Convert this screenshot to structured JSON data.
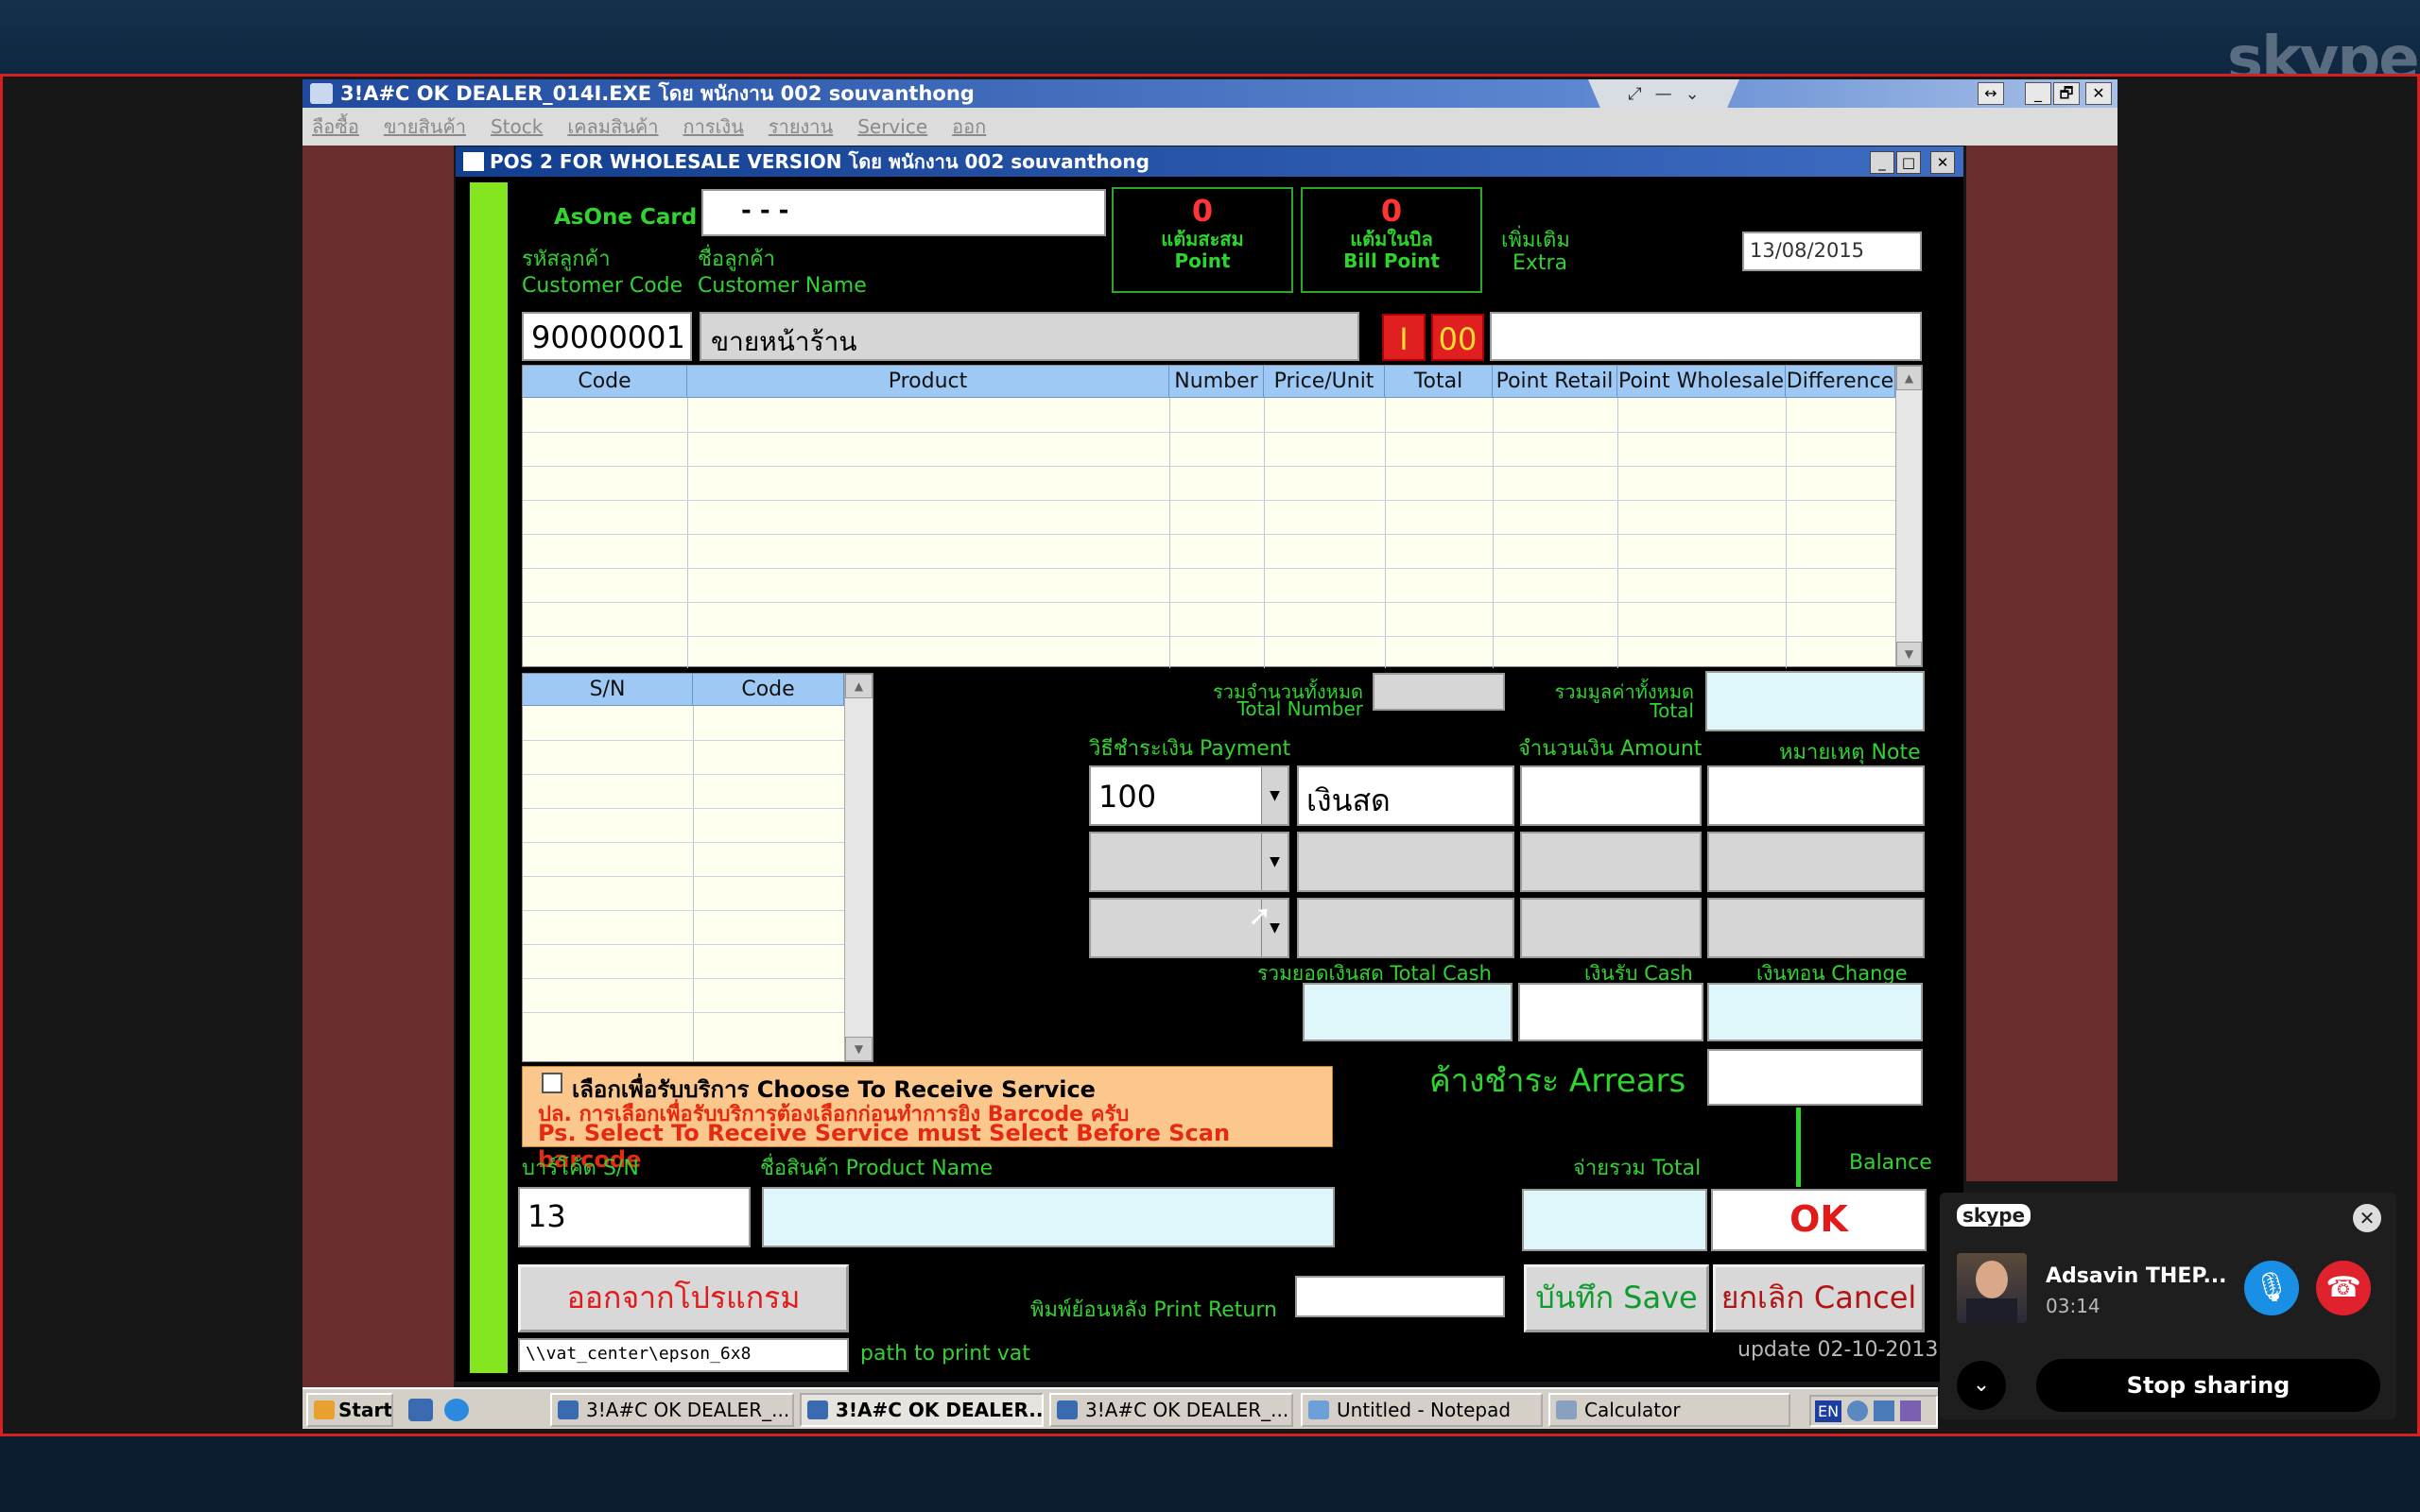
{
  "skype": {
    "brand": "skype",
    "caller_name": "Adsavin THEP...",
    "call_time": "03:14",
    "stop_sharing": "Stop sharing"
  },
  "outer_window": {
    "title": "3!A#C OK DEALER_014I.EXE โดย พนักงาน 002 souvanthong",
    "buttons": [
      "↔",
      "_",
      "🗗",
      "✕"
    ]
  },
  "menu": [
    "ลือซื้อ",
    "ขายสินค้า",
    "Stock",
    "เคลมสินค้า",
    "การเงิน",
    "รายงาน",
    "Service",
    "ออก"
  ],
  "inner_window": {
    "title": "POS 2 FOR WHOLESALE VERSION โดย พนักงาน 002 souvanthong",
    "buttons": [
      "_",
      "□",
      "✕"
    ]
  },
  "header": {
    "asone_label": "AsOne Card",
    "asone_value": "-   -   -",
    "cust_code_th": "รหัสลูกค้า",
    "cust_code_en": "Customer Code",
    "cust_name_th": "ชื่อลูกค้า",
    "cust_name_en": "Customer Name",
    "point_value": "0",
    "point_th": "แต้มสะสม",
    "point_en": "Point",
    "bill_point_value": "0",
    "bill_point_th": "แต้มในบิล",
    "bill_point_en": "Bill Point",
    "extra_th": "เพิ่มเติม",
    "extra_en": "Extra",
    "date": "13/08/2015",
    "customer_code": "90000001",
    "customer_name": "ขายหน้าร้าน",
    "flag_i": "I",
    "flag_00": "00",
    "extra_value": ""
  },
  "product_table": {
    "columns": [
      "Code",
      "Product",
      "Number",
      "Price/Unit",
      "Total",
      "Point Retail",
      "Point Wholesale",
      "Difference"
    ],
    "rows": []
  },
  "sn_table": {
    "columns": [
      "S/N",
      "Code"
    ],
    "rows": []
  },
  "totals": {
    "total_number_th": "รวมจำนวนทั้งหมด",
    "total_number_en": "Total Number",
    "total_number": "",
    "total_value_th": "รวมมูลค่าทั้งหมด",
    "total_value_en": "Total",
    "total_value": ""
  },
  "payment": {
    "method_label": "วิธีชำระเงิน Payment",
    "amount_label": "จำนวนเงิน Amount",
    "note_label": "หมายเหตุ Note",
    "row1_code": "100",
    "row1_name": "เงินสด",
    "row1_amount": "",
    "row1_note": "",
    "total_cash_label": "รวมยอดเงินสด Total Cash",
    "cash_label": "เงินรับ Cash",
    "change_label": "เงินทอน Change",
    "total_cash": "",
    "cash": "",
    "change": ""
  },
  "service": {
    "checkbox_label": "เลือกเพื่อรับบริการ Choose To Receive Service",
    "note_th": "ปล. การเลือกเพื่อรับบริการต้องเลือกก่อนทำการยิง Barcode ครับ",
    "note_en": "Ps. Select To Receive Service must Select Before Scan barcode",
    "checked": false
  },
  "arrears": {
    "label": "ค้างชำระ Arrears",
    "value": ""
  },
  "barcode": {
    "sn_label": "บาร์โค้ด S/N",
    "product_label": "ชื่อสินค้า Product Name",
    "sn_value": "13",
    "product_value": ""
  },
  "bottom": {
    "total_label": "จ่ายรวม Total",
    "balance_label": "Balance",
    "total_value": "",
    "ok": "OK",
    "close": "ออกจากโปรแกรม Close",
    "print_return_label": "พิมพ์ย้อนหลัง Print Return",
    "print_return_value": "",
    "save": "บันทึก Save",
    "cancel": "ยกเลิก Cancel",
    "path_value": "\\\\vat_center\\epson_6x8",
    "path_label": "path to print vat",
    "update": "update 02-10-2013"
  },
  "taskbar": {
    "start": "Start",
    "tasks": [
      "3!A#C OK DEALER_...",
      "3!A#C OK DEALER...",
      "3!A#C OK DEALER_...",
      "Untitled - Notepad",
      "Calculator"
    ],
    "tray_lang": "EN"
  }
}
